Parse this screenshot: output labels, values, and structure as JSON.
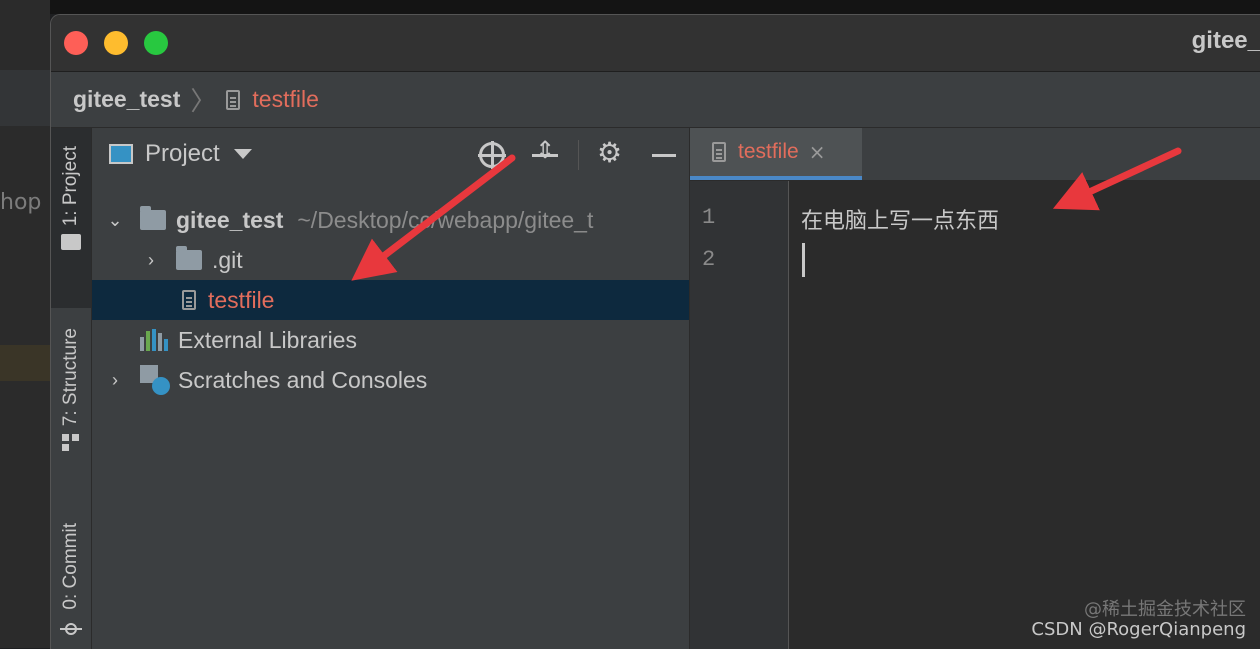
{
  "window": {
    "title": "gitee_t"
  },
  "background": {
    "side_text": "hop"
  },
  "navbar": {
    "project": "gitee_test",
    "file": "testfile"
  },
  "toolstrip": {
    "project": "1: Project",
    "structure": "7: Structure",
    "commit": "0: Commit"
  },
  "project_panel": {
    "title": "Project",
    "tree": {
      "root_name": "gitee_test",
      "root_path": "~/Desktop/cc/webapp/gitee_t",
      "git": ".git",
      "file": "testfile",
      "external": "External Libraries",
      "scratches": "Scratches and Consoles"
    }
  },
  "editor": {
    "tab_label": "testfile",
    "tab_close": "×",
    "line_numbers": [
      "1",
      "2"
    ],
    "lines": [
      "在电脑上写一点东西",
      ""
    ]
  },
  "watermark": {
    "line1": "@稀土掘金技术社区",
    "line2": "CSDN @RogerQianpeng"
  },
  "colors": {
    "accent_red": "#e26d5c",
    "selection": "#0d293e",
    "tab_underline": "#4a88c7",
    "arrow": "#e8383d"
  },
  "icons": {
    "crosshair": "crosshair-icon",
    "collapse": "collapse-all-icon",
    "gear": "gear-icon",
    "minus": "hide-panel-icon"
  }
}
